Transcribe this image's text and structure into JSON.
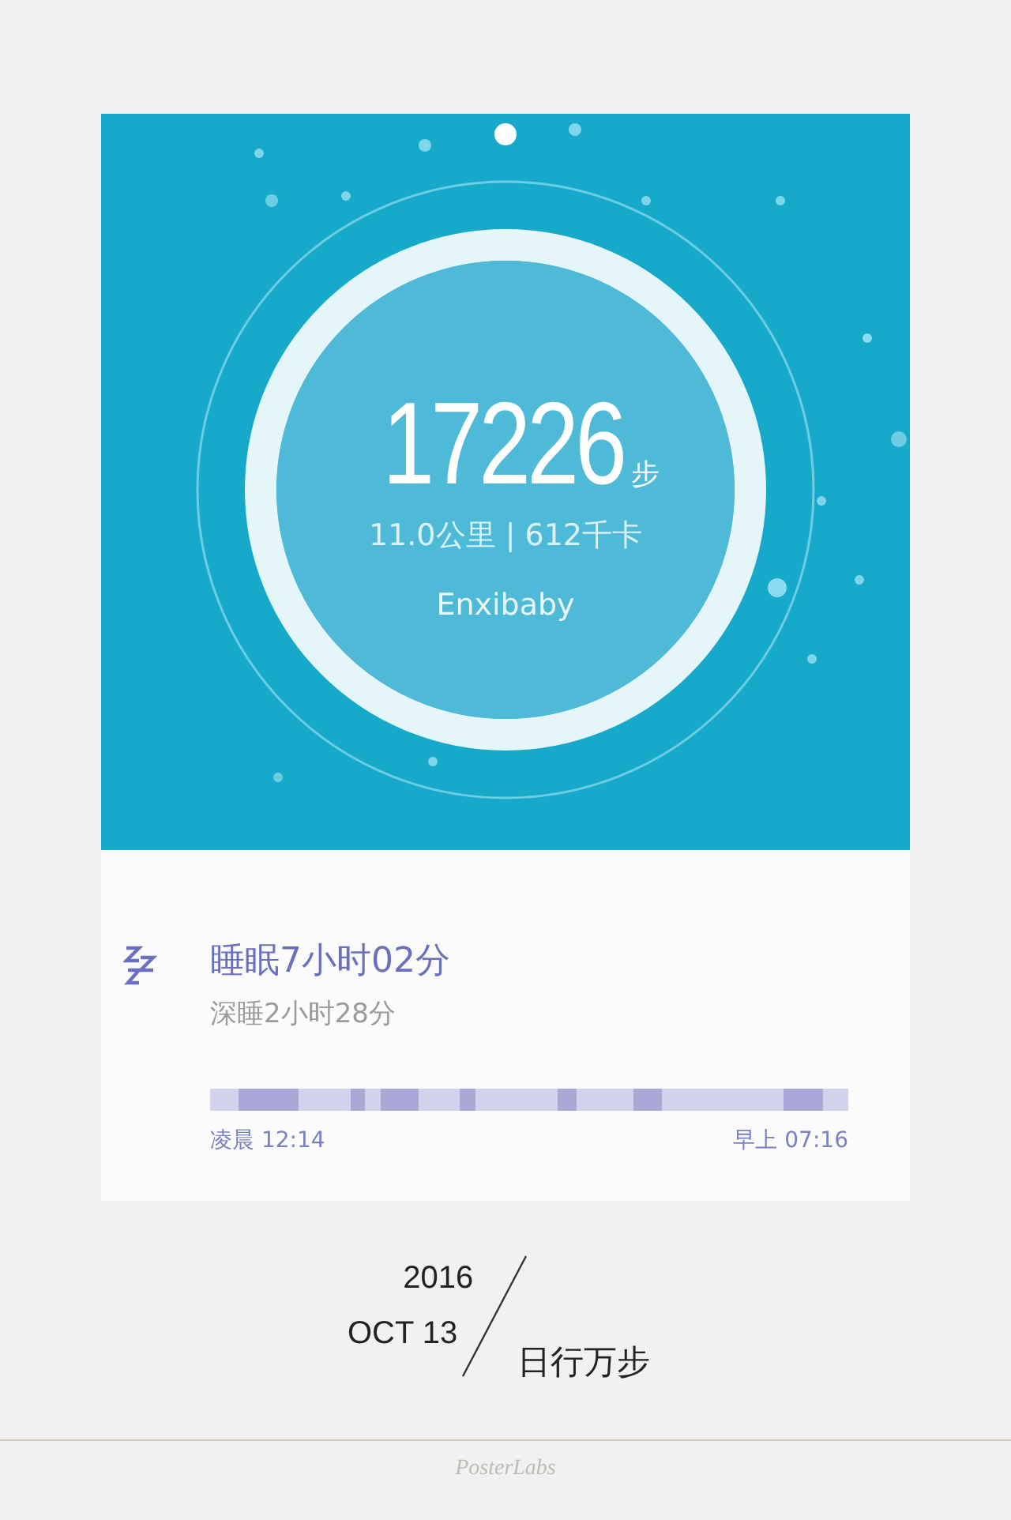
{
  "activity": {
    "steps": "17226",
    "steps_unit": "步",
    "stats": "11.0公里 | 612千卡",
    "user": "Enxibaby"
  },
  "sleep": {
    "title": "睡眠7小时02分",
    "deep_sleep": "深睡2小时28分",
    "start": "凌晨 12:14",
    "end": "早上 07:16"
  },
  "date": {
    "year": "2016",
    "day": "OCT 13",
    "caption": "日行万步"
  },
  "footer": "PosterLabs"
}
